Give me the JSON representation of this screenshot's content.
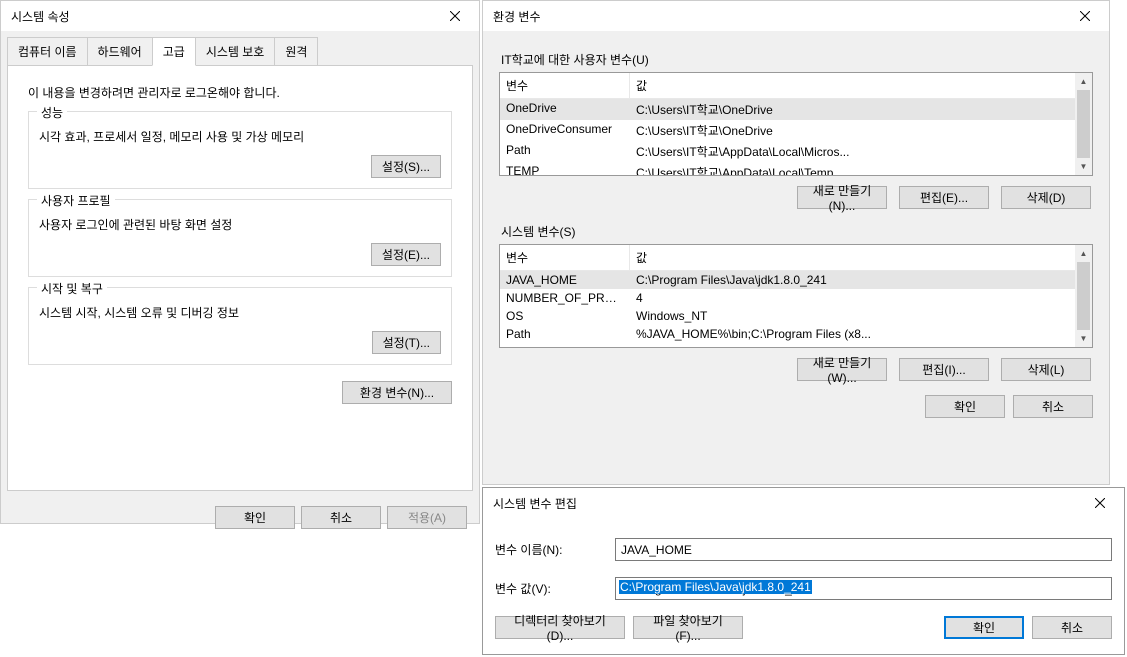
{
  "sysProps": {
    "title": "시스템 속성",
    "tabs": {
      "computerName": "컴퓨터 이름",
      "hardware": "하드웨어",
      "advanced": "고급",
      "systemProtect": "시스템 보호",
      "remote": "원격"
    },
    "adminNote": "이 내용을 변경하려면 관리자로 로그온해야 합니다.",
    "perf": {
      "label": "성능",
      "desc": "시각 효과, 프로세서 일정, 메모리 사용 및 가상 메모리",
      "btn": "설정(S)..."
    },
    "profile": {
      "label": "사용자 프로필",
      "desc": "사용자 로그인에 관련된 바탕 화면 설정",
      "btn": "설정(E)..."
    },
    "startup": {
      "label": "시작 및 복구",
      "desc": "시스템 시작, 시스템 오류 및 디버깅 정보",
      "btn": "설정(T)..."
    },
    "envVarsBtn": "환경 변수(N)...",
    "ok": "확인",
    "cancel": "취소",
    "apply": "적용(A)"
  },
  "envDialog": {
    "title": "환경 변수",
    "userLabel": "IT학교에 대한 사용자 변수(U)",
    "sysLabel": "시스템 변수(S)",
    "colVar": "변수",
    "colVal": "값",
    "userVars": [
      {
        "name": "OneDrive",
        "value": "C:\\Users\\IT학교\\OneDrive"
      },
      {
        "name": "OneDriveConsumer",
        "value": "C:\\Users\\IT학교\\OneDrive"
      },
      {
        "name": "Path",
        "value": "C:\\Users\\IT학교\\AppData\\Local\\Micros..."
      },
      {
        "name": "TEMP",
        "value": "C:\\Users\\IT학교\\AppData\\Local\\Temp"
      }
    ],
    "sysVars": [
      {
        "name": "JAVA_HOME",
        "value": "C:\\Program Files\\Java\\jdk1.8.0_241"
      },
      {
        "name": "NUMBER_OF_PRO...",
        "value": "4"
      },
      {
        "name": "OS",
        "value": "Windows_NT"
      },
      {
        "name": "Path",
        "value": "%JAVA_HOME%\\bin;C:\\Program Files (x8..."
      }
    ],
    "newN": "새로 만들기(N)...",
    "editE": "편집(E)...",
    "delD": "삭제(D)",
    "newW": "새로 만들기(W)...",
    "editI": "편집(I)...",
    "delL": "삭제(L)",
    "ok": "확인",
    "cancel": "취소"
  },
  "editDialog": {
    "title": "시스템 변수 편집",
    "nameLabel": "변수 이름(N):",
    "valueLabel": "변수 값(V):",
    "nameValue": "JAVA_HOME",
    "valueValue": "C:\\Program Files\\Java\\jdk1.8.0_241",
    "browseDir": "디렉터리 찾아보기(D)...",
    "browseFile": "파일 찾아보기(F)...",
    "ok": "확인",
    "cancel": "취소"
  }
}
